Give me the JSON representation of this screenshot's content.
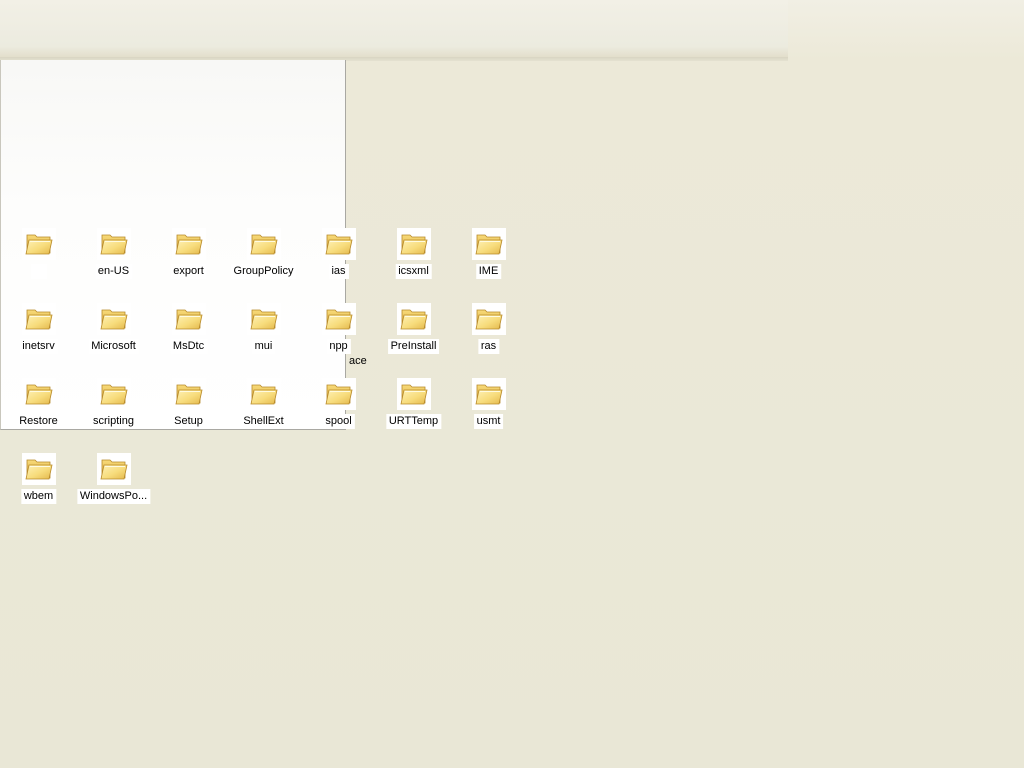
{
  "desktop": {
    "background_color": "#ece9d8",
    "overlapping_text": "ace",
    "folders": [
      {
        "label": "",
        "icon": "folder-icon"
      },
      {
        "label": "en-US",
        "icon": "folder-icon"
      },
      {
        "label": "export",
        "icon": "folder-icon"
      },
      {
        "label": "GroupPolicy",
        "icon": "folder-icon"
      },
      {
        "label": "ias",
        "icon": "folder-icon"
      },
      {
        "label": "icsxml",
        "icon": "folder-icon"
      },
      {
        "label": "IME",
        "icon": "folder-icon"
      },
      {
        "label": "inetsrv",
        "icon": "folder-icon"
      },
      {
        "label": "Microsoft",
        "icon": "folder-icon"
      },
      {
        "label": "MsDtc",
        "icon": "folder-icon"
      },
      {
        "label": "mui",
        "icon": "folder-icon"
      },
      {
        "label": "npp",
        "icon": "folder-icon"
      },
      {
        "label": "PreInstall",
        "icon": "folder-icon"
      },
      {
        "label": "ras",
        "icon": "folder-icon"
      },
      {
        "label": "Restore",
        "icon": "folder-icon"
      },
      {
        "label": "scripting",
        "icon": "folder-icon"
      },
      {
        "label": "Setup",
        "icon": "folder-icon"
      },
      {
        "label": "ShellExt",
        "icon": "folder-icon"
      },
      {
        "label": "spool",
        "icon": "folder-icon"
      },
      {
        "label": "URTTemp",
        "icon": "folder-icon"
      },
      {
        "label": "usmt",
        "icon": "folder-icon"
      },
      {
        "label": "wbem",
        "icon": "folder-icon"
      },
      {
        "label": "WindowsPo...",
        "icon": "folder-icon"
      }
    ]
  }
}
